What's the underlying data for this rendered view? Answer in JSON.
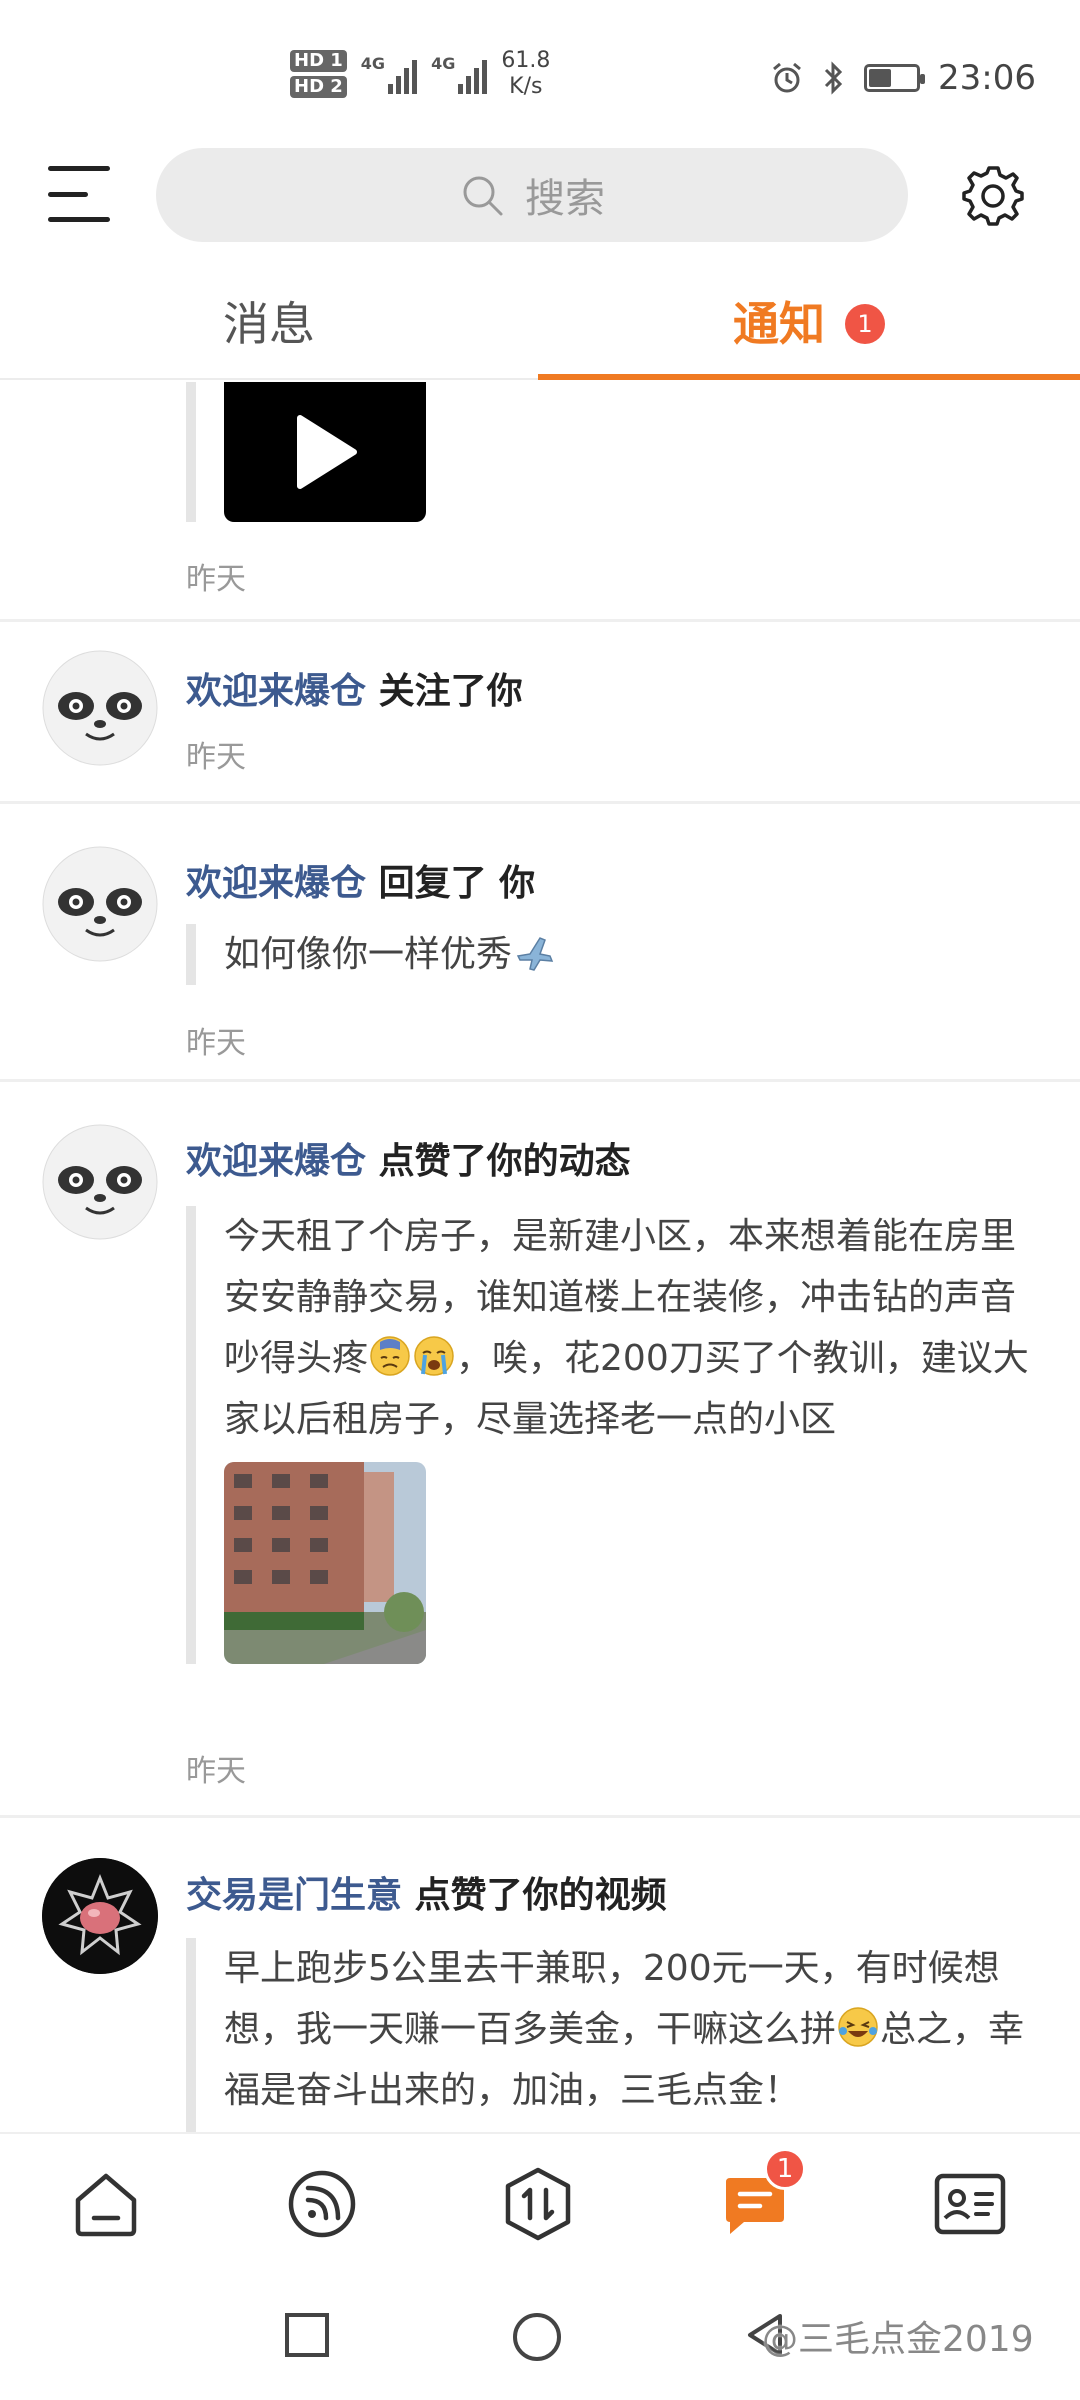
{
  "status_bar": {
    "sim1": "HD 1",
    "sim2": "HD 2",
    "net1": "4G",
    "net2": "4G",
    "speed_value": "61.8",
    "speed_unit": "K/s",
    "time": "23:06",
    "battery_level": 0.45,
    "icons": [
      "alarm-icon",
      "bluetooth-icon",
      "battery-icon"
    ]
  },
  "topbar": {
    "search_placeholder": "搜索"
  },
  "tabs": [
    {
      "label": "消息",
      "active": false
    },
    {
      "label": "通知",
      "active": true,
      "badge": "1"
    }
  ],
  "accent_color": "#f07a22",
  "username_color": "#3d5a8f",
  "notifications": [
    {
      "type": "video",
      "time": "昨天"
    },
    {
      "user": "欢迎来爆仓",
      "action": "关注了你",
      "time": "昨天"
    },
    {
      "user": "欢迎来爆仓",
      "action": "回复了 你",
      "content": "如何像你一样优秀",
      "time": "昨天"
    },
    {
      "user": "欢迎来爆仓",
      "action": "点赞了你的动态",
      "content": "今天租了个房子，是新建小区，本来想着能在房里安安静静交易，谁知道楼上在装修，冲击钻的声音吵得头疼",
      "content_tail": "，唉，花200刀买了个教训，建议大家以后租房子，尽量选择老一点的小区",
      "time": "昨天"
    },
    {
      "user": "交易是门生意",
      "action": "点赞了你的视频",
      "content": "早上跑步5公里去干兼职，200元一天，有时候想想，我一天赚一百多美金，干嘛这么拼",
      "content_tail": "总之，幸福是奋斗出来的，加油，三毛点金！"
    }
  ],
  "bottom_nav": [
    {
      "name": "home",
      "icon": "home-icon"
    },
    {
      "name": "feed",
      "icon": "rss-icon"
    },
    {
      "name": "trade",
      "icon": "trade-icon"
    },
    {
      "name": "messages",
      "icon": "chat-icon",
      "badge": "1",
      "active": true
    },
    {
      "name": "profile",
      "icon": "id-card-icon"
    }
  ],
  "watermark": "@三毛点金2019"
}
